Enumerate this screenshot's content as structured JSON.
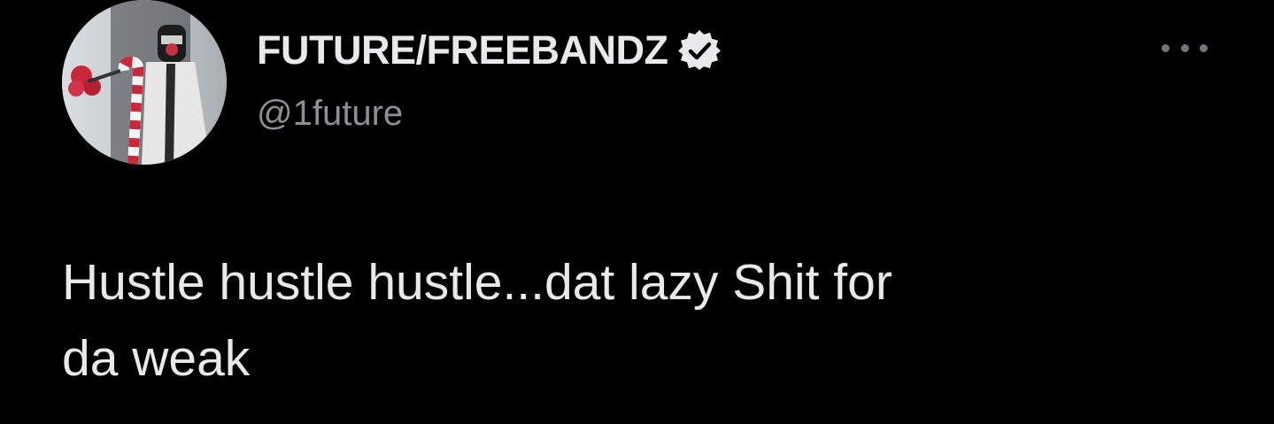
{
  "tweet": {
    "display_name": "FUTURE/FREEBANDZ",
    "handle": "@1future",
    "text": "Hustle hustle hustle...dat lazy Shit for\nda weak",
    "verified": true,
    "icons": {
      "verified": "verified-badge-icon",
      "more": "more-options-icon",
      "avatar": "profile-photo"
    }
  },
  "colors": {
    "background": "#000000",
    "primary_text": "#e7e9ea",
    "secondary_text": "#8b9096",
    "more_icon": "#6e767d"
  }
}
